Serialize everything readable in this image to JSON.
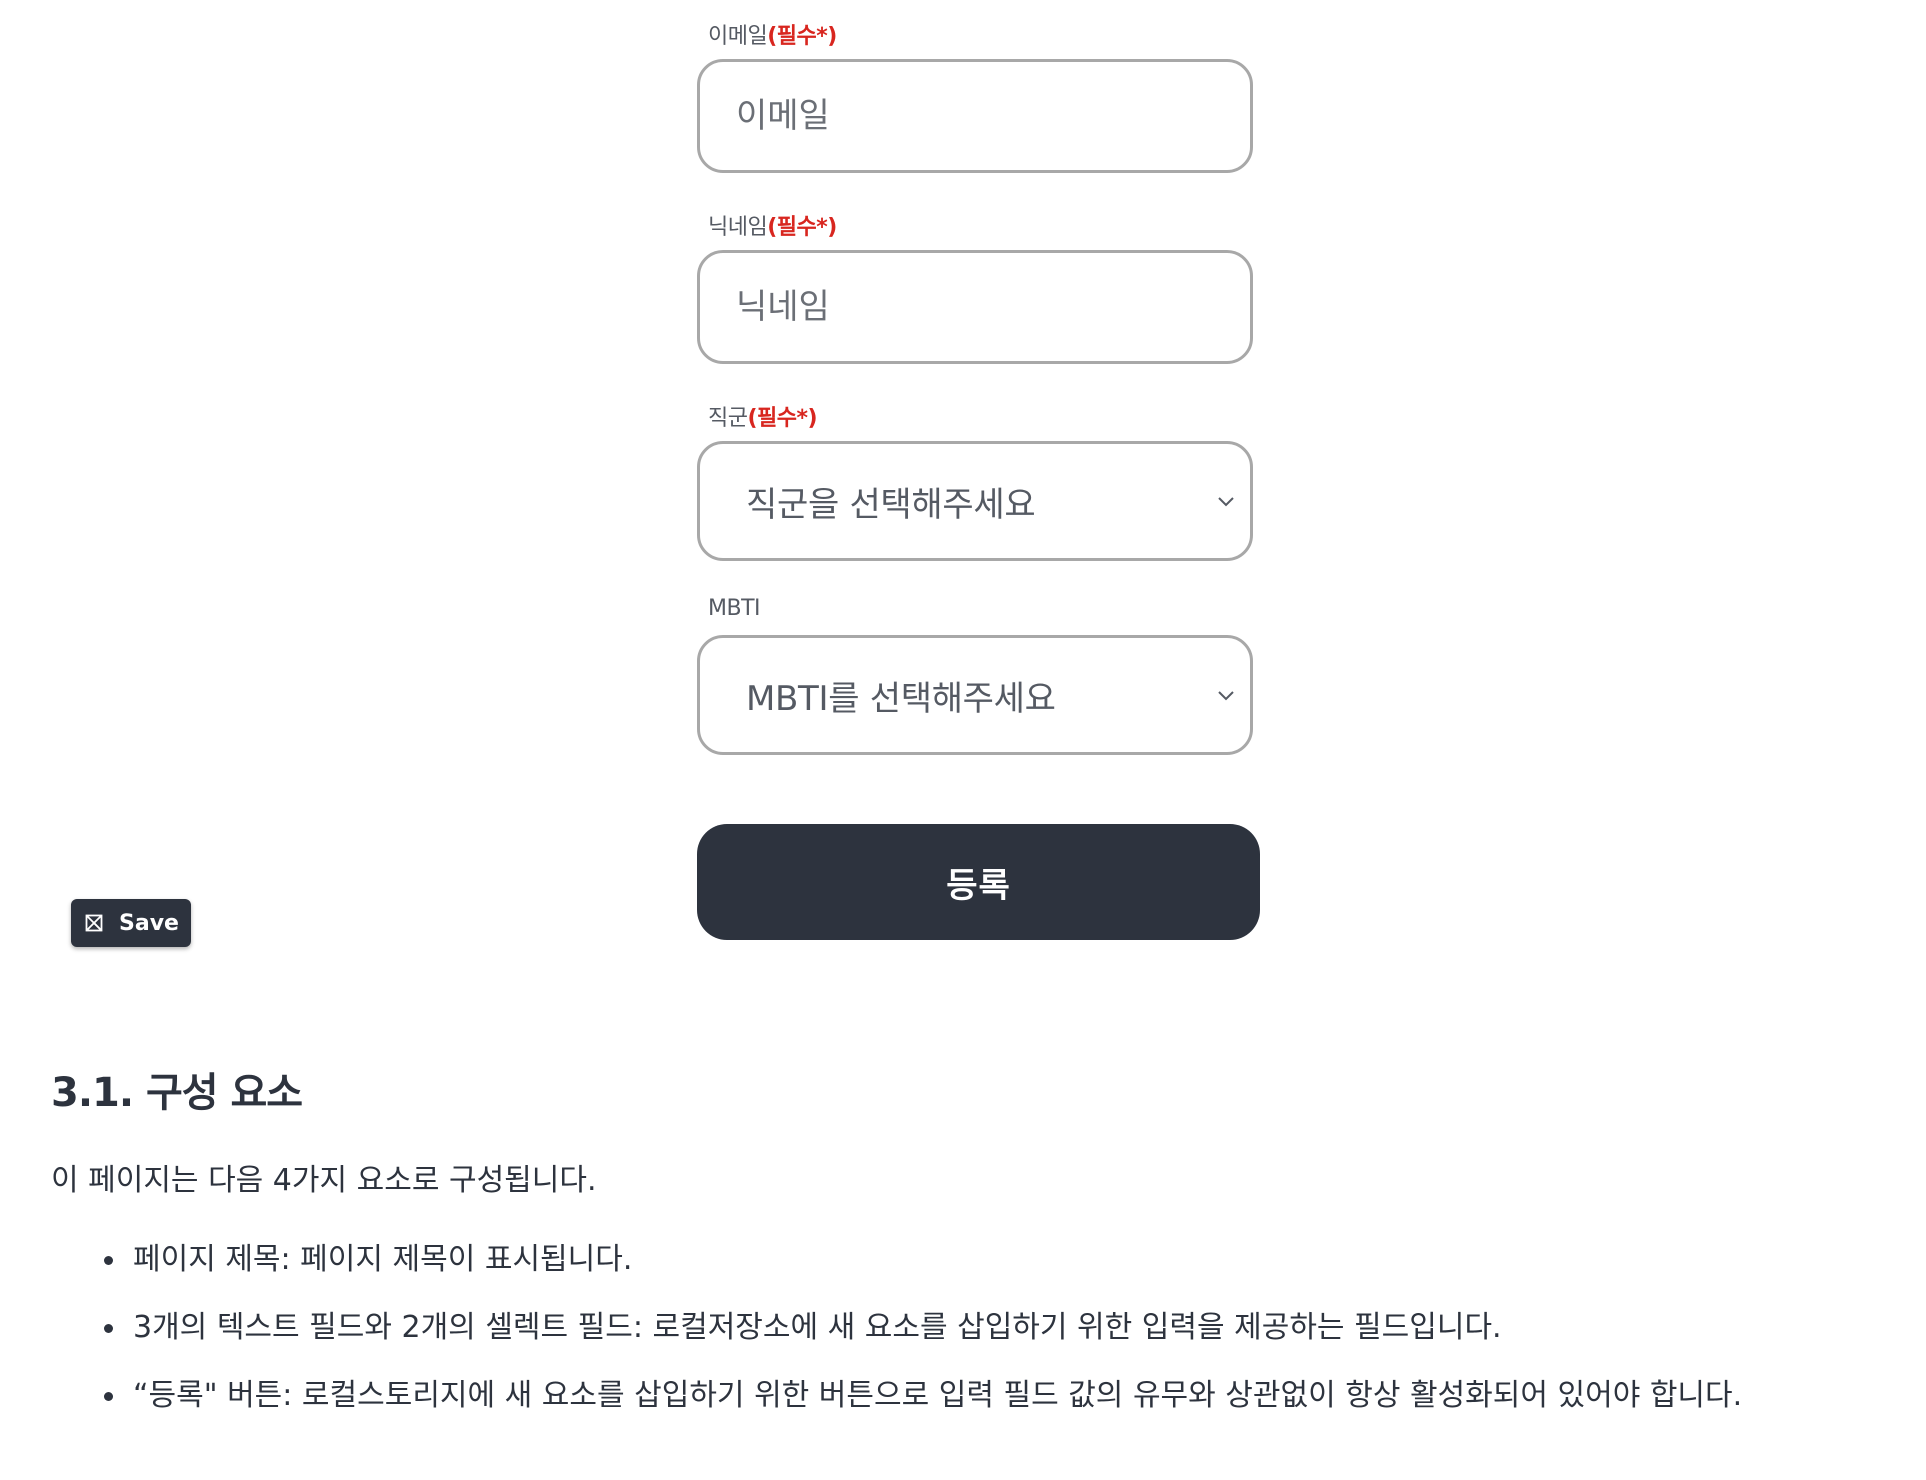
{
  "form": {
    "email": {
      "label": "이메일",
      "required": "(필수*)",
      "placeholder": "이메일"
    },
    "nickname": {
      "label": "닉네임",
      "required": "(필수*)",
      "placeholder": "닉네임"
    },
    "job": {
      "label": "직군",
      "required": "(필수*)",
      "selected": "직군을 선택해주세요"
    },
    "mbti": {
      "label": "MBTI",
      "selected": "MBTI를 선택해주세요"
    },
    "submit_label": "등록"
  },
  "save_button": {
    "label": "Save",
    "icon": "save-icon"
  },
  "doc": {
    "heading": "3.1. 구성 요소",
    "intro": "이 페이지는 다음 4가지 요소로 구성됩니다.",
    "items": [
      "페이지 제목: 페이지 제목이 표시됩니다.",
      "3개의 텍스트 필드와 2개의 셀렉트 필드: 로컬저장소에 새 요소를 삽입하기 위한 입력을 제공하는 필드입니다.",
      "“등록\" 버튼: 로컬스토리지에 새 요소를 삽입하기 위한 버튼으로 입력 필드 값의 유무와 상관없이 항상 활성화되어 있어야 합니다."
    ]
  },
  "colors": {
    "required": "#d8261f",
    "button_bg": "#2d333e",
    "border": "#a8a8a8"
  }
}
